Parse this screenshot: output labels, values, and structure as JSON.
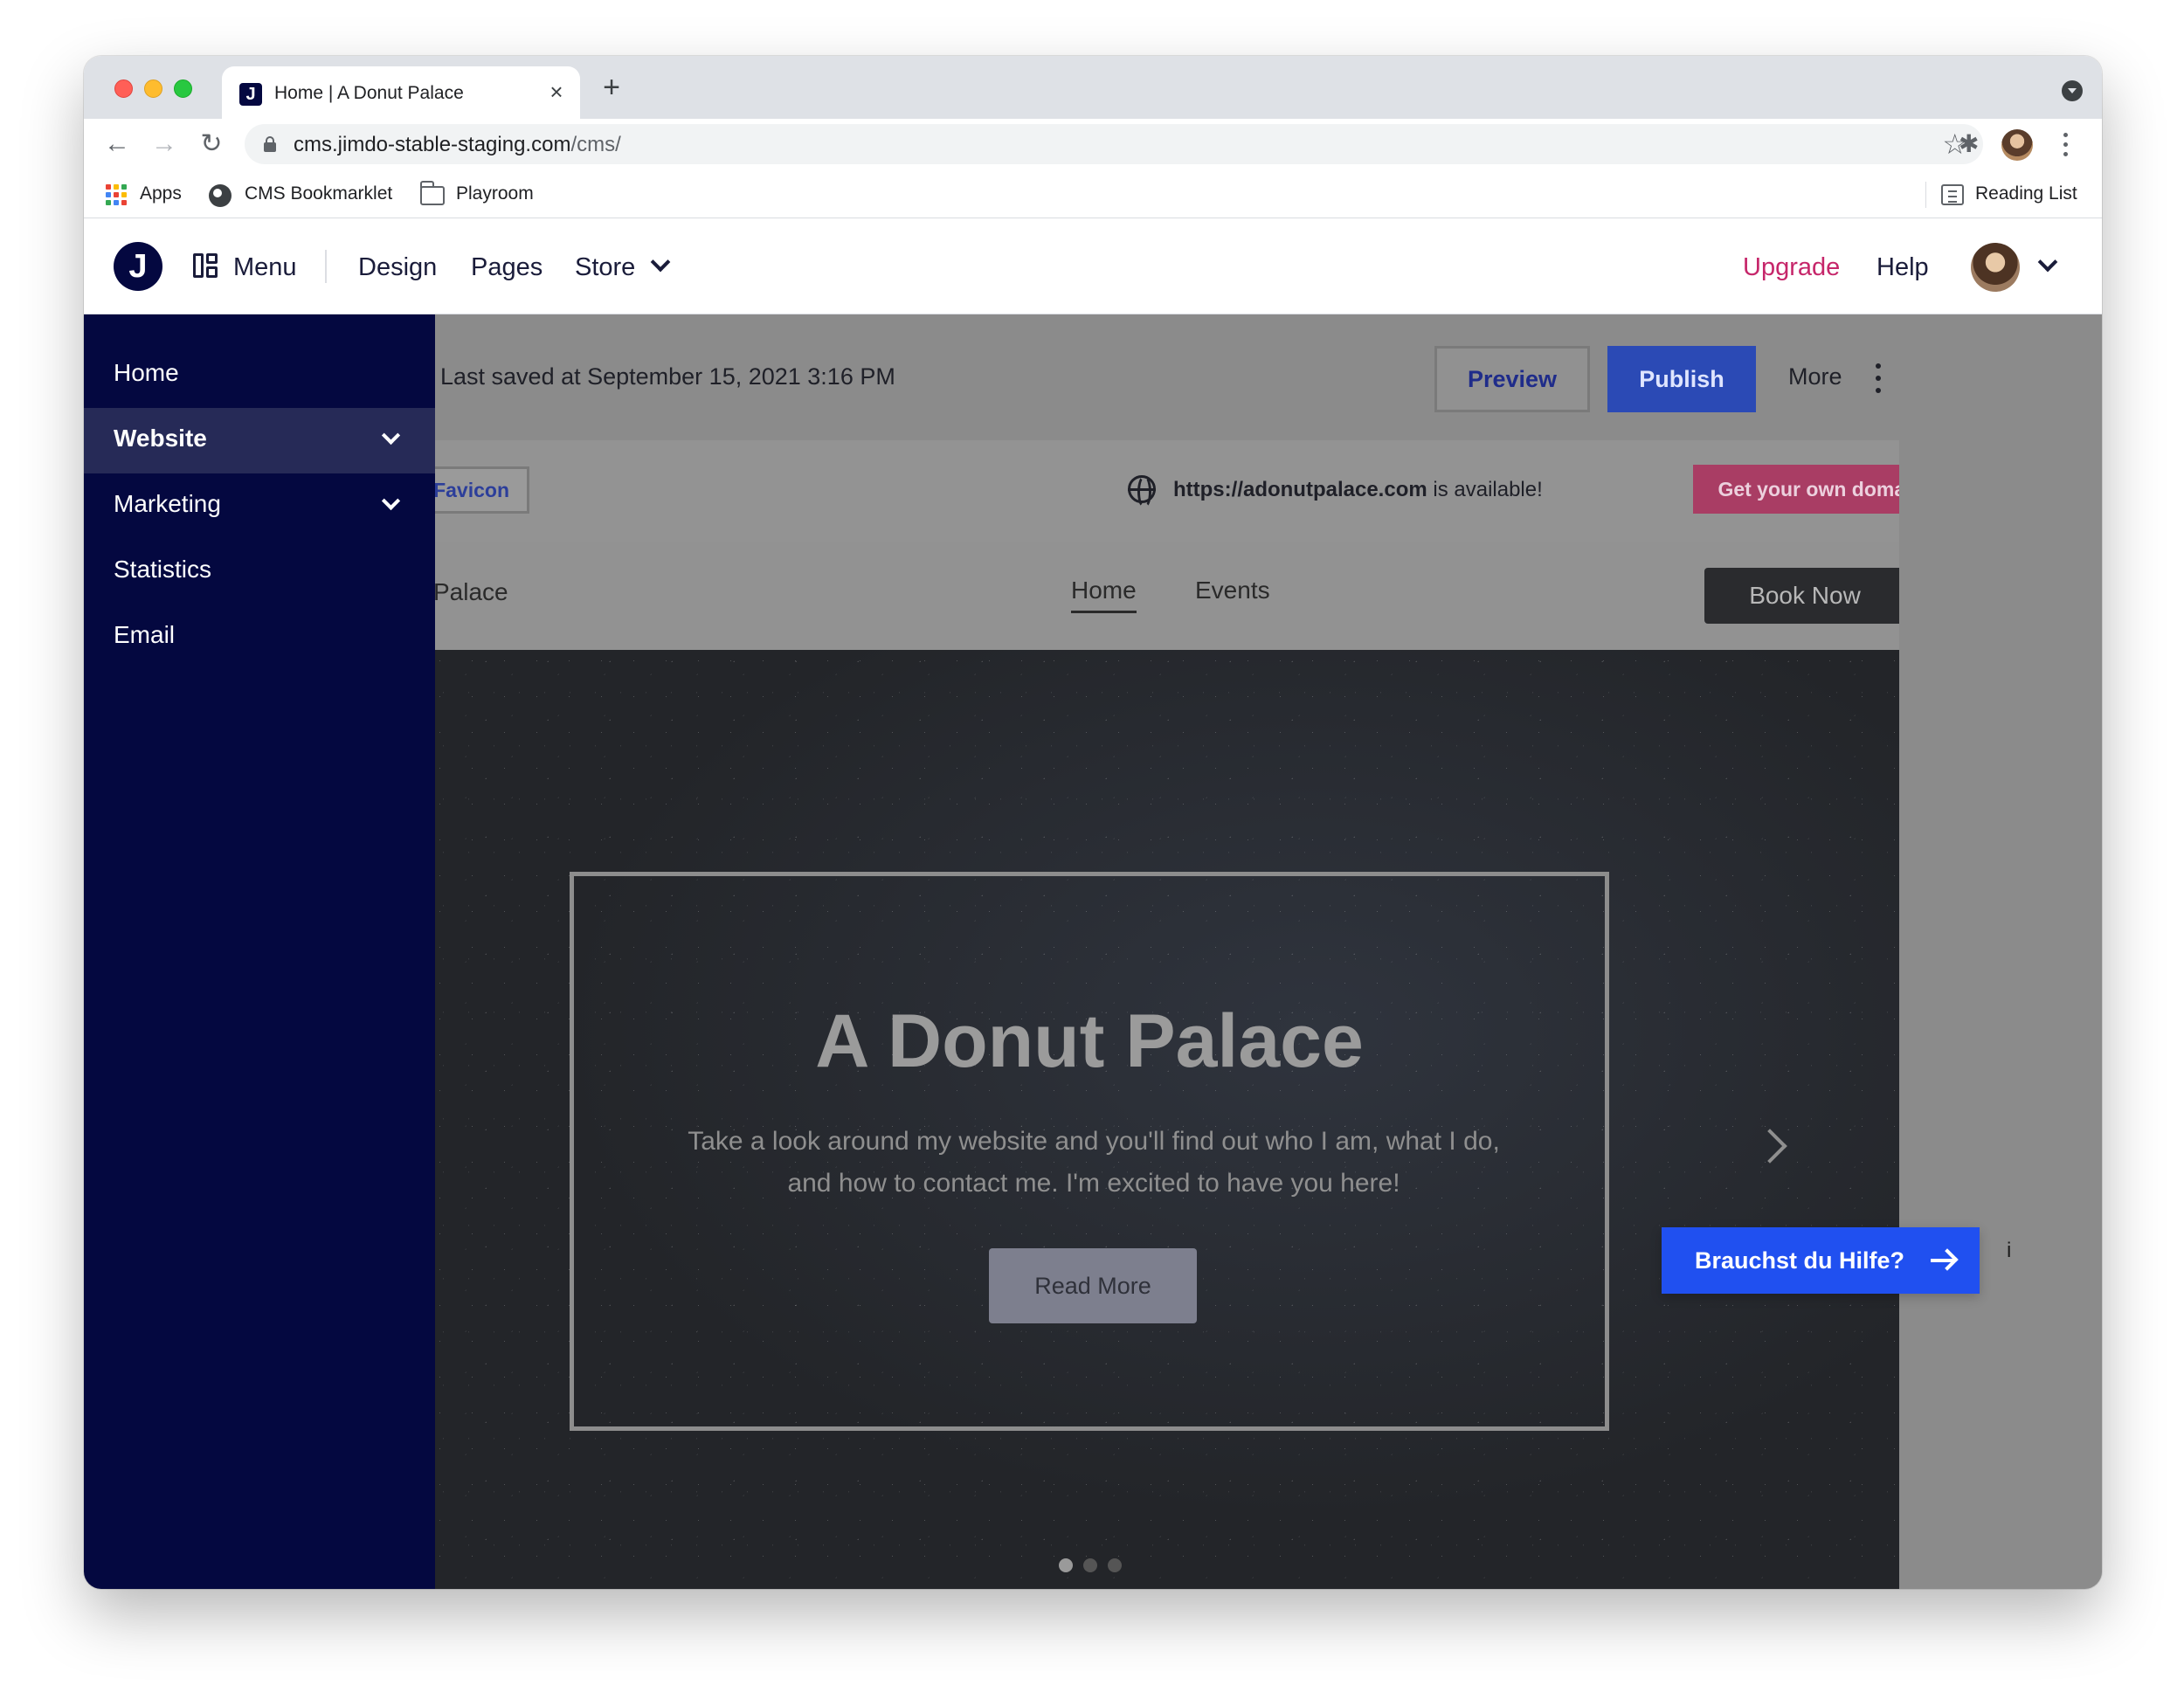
{
  "browser": {
    "tab_title": "Home | A Donut Palace",
    "tab_favicon_letter": "J",
    "url_domain": "cms.jimdo-stable-staging.com",
    "url_path": "/cms/",
    "bookmarks": {
      "apps": "Apps",
      "cms_bookmarklet": "CMS Bookmarklet",
      "playroom": "Playroom",
      "reading_list": "Reading List"
    }
  },
  "appbar": {
    "logo_letter": "J",
    "menu": "Menu",
    "design": "Design",
    "pages": "Pages",
    "store": "Store",
    "upgrade": "Upgrade",
    "help": "Help",
    "upgrade_color": "#c6266a"
  },
  "editor": {
    "last_saved": "Last saved at September 15, 2021 3:16 PM",
    "preview": "Preview",
    "publish": "Publish",
    "more": "More"
  },
  "site": {
    "favicon_button": "Favicon",
    "domain_url": "https://adonutpalace.com",
    "domain_suffix": " is available!",
    "get_domain": "Get your own domain",
    "brand_partial": "Palace",
    "nav": [
      "Home",
      "Events"
    ],
    "book_now": "Book Now",
    "hero_title": "A Donut Palace",
    "hero_subtitle": "Take a look around my website and you'll find out who I am, what I do, and how to contact me. I'm excited to have you here!",
    "read_more": "Read More",
    "slide_count": 3,
    "active_slide": 1
  },
  "sidebar": {
    "items": [
      {
        "label": "Home",
        "expandable": false,
        "active": false
      },
      {
        "label": "Website",
        "expandable": true,
        "active": true
      },
      {
        "label": "Marketing",
        "expandable": true,
        "active": false
      },
      {
        "label": "Statistics",
        "expandable": false,
        "active": false
      },
      {
        "label": "Email",
        "expandable": false,
        "active": false
      }
    ],
    "background": "#040840"
  },
  "help_widget": {
    "label": "Brauchst du Hilfe?",
    "color": "#2050f0",
    "info_glyph": "i"
  },
  "icons": [
    "close-icon",
    "plus-icon",
    "back-arrow-icon",
    "forward-arrow-icon",
    "reload-icon",
    "lock-icon",
    "star-icon",
    "puzzle-icon",
    "kebab-icon",
    "apps-grid-icon",
    "globe-icon",
    "folder-icon",
    "reading-list-icon",
    "menu-layout-icon",
    "chevron-down-icon",
    "chevron-right-icon",
    "arrow-right-icon"
  ]
}
